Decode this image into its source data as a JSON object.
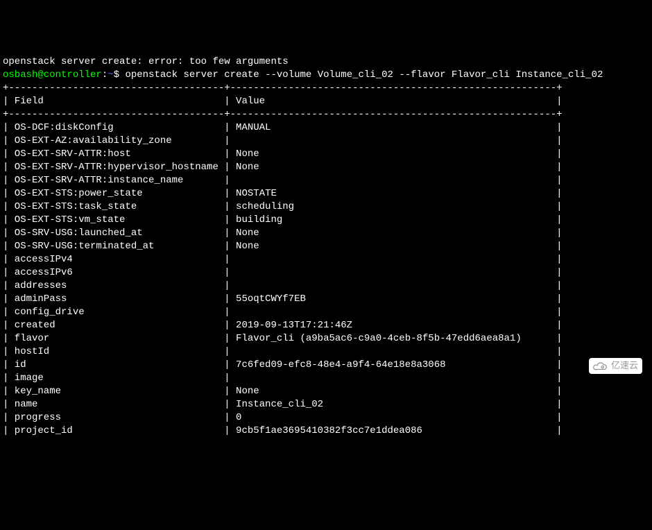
{
  "error_line": "openstack server create: error: too few arguments",
  "prompt_user_host": "osbash@controller",
  "prompt_colon": ":",
  "prompt_path": "~",
  "prompt_dollar": "$ ",
  "command": "openstack server create --volume Volume_cli_02 --flavor Flavor_cli Instance_cli_02",
  "border_top": "+-------------------------------------+--------------------------------------------------------+",
  "header_field": "Field",
  "header_value": "Value",
  "rows": [
    {
      "field": "OS-DCF:diskConfig",
      "value": "MANUAL"
    },
    {
      "field": "OS-EXT-AZ:availability_zone",
      "value": ""
    },
    {
      "field": "OS-EXT-SRV-ATTR:host",
      "value": "None"
    },
    {
      "field": "OS-EXT-SRV-ATTR:hypervisor_hostname",
      "value": "None"
    },
    {
      "field": "OS-EXT-SRV-ATTR:instance_name",
      "value": ""
    },
    {
      "field": "OS-EXT-STS:power_state",
      "value": "NOSTATE"
    },
    {
      "field": "OS-EXT-STS:task_state",
      "value": "scheduling"
    },
    {
      "field": "OS-EXT-STS:vm_state",
      "value": "building"
    },
    {
      "field": "OS-SRV-USG:launched_at",
      "value": "None"
    },
    {
      "field": "OS-SRV-USG:terminated_at",
      "value": "None"
    },
    {
      "field": "accessIPv4",
      "value": ""
    },
    {
      "field": "accessIPv6",
      "value": ""
    },
    {
      "field": "addresses",
      "value": ""
    },
    {
      "field": "adminPass",
      "value": "55oqtCWYf7EB"
    },
    {
      "field": "config_drive",
      "value": ""
    },
    {
      "field": "created",
      "value": "2019-09-13T17:21:46Z"
    },
    {
      "field": "flavor",
      "value": "Flavor_cli (a9ba5ac6-c9a0-4ceb-8f5b-47edd6aea8a1)"
    },
    {
      "field": "hostId",
      "value": ""
    },
    {
      "field": "id",
      "value": "7c6fed09-efc8-48e4-a9f4-64e18e8a3068"
    },
    {
      "field": "image",
      "value": ""
    },
    {
      "field": "key_name",
      "value": "None"
    },
    {
      "field": "name",
      "value": "Instance_cli_02"
    },
    {
      "field": "progress",
      "value": "0"
    },
    {
      "field": "project_id",
      "value": "9cb5f1ae3695410382f3cc7e1ddea086"
    }
  ],
  "col1_width": 37,
  "col2_width": 56,
  "watermark_text": "亿速云"
}
